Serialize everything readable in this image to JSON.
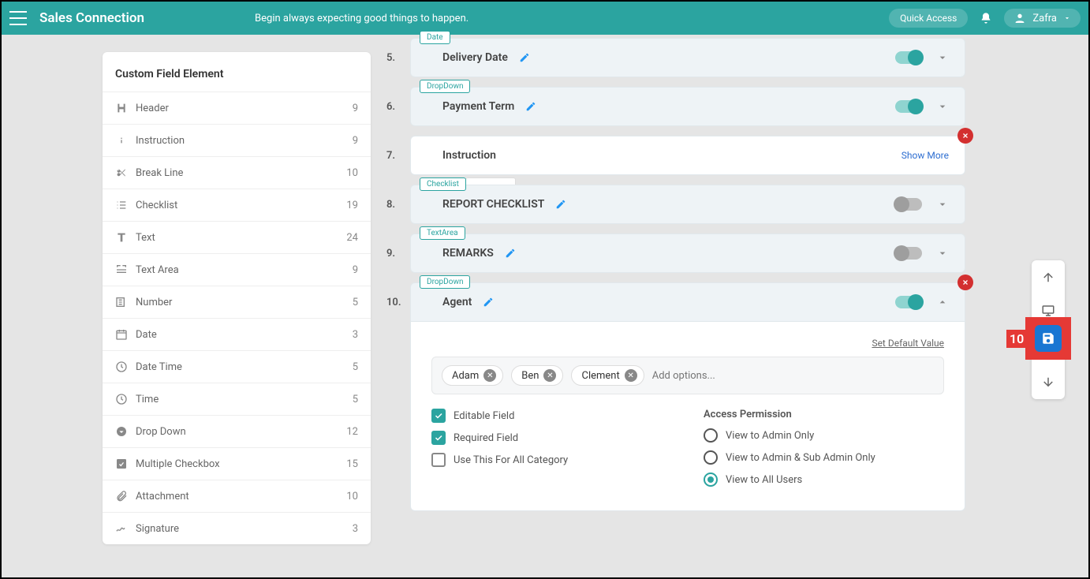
{
  "header": {
    "brand": "Sales Connection",
    "motto": "Begin always expecting good things to happen.",
    "quick_access": "Quick Access",
    "user_name": "Zafra"
  },
  "sidebar": {
    "title": "Custom Field Element",
    "items": [
      {
        "label": "Header",
        "count": "9",
        "iconkey": "header"
      },
      {
        "label": "Instruction",
        "count": "9",
        "iconkey": "info"
      },
      {
        "label": "Break Line",
        "count": "10",
        "iconkey": "cut"
      },
      {
        "label": "Checklist",
        "count": "19",
        "iconkey": "list"
      },
      {
        "label": "Text",
        "count": "24",
        "iconkey": "text"
      },
      {
        "label": "Text Area",
        "count": "9",
        "iconkey": "textarea"
      },
      {
        "label": "Number",
        "count": "5",
        "iconkey": "number"
      },
      {
        "label": "Date",
        "count": "3",
        "iconkey": "date"
      },
      {
        "label": "Date Time",
        "count": "5",
        "iconkey": "clock"
      },
      {
        "label": "Time",
        "count": "5",
        "iconkey": "clock"
      },
      {
        "label": "Drop Down",
        "count": "12",
        "iconkey": "dropdown"
      },
      {
        "label": "Multiple Checkbox",
        "count": "15",
        "iconkey": "mcheck"
      },
      {
        "label": "Attachment",
        "count": "10",
        "iconkey": "attach"
      },
      {
        "label": "Signature",
        "count": "3",
        "iconkey": "sign"
      }
    ]
  },
  "fields": [
    {
      "num": "5.",
      "tag": "Date",
      "title": "Delivery Date",
      "toggle": "on",
      "chev": "down"
    },
    {
      "num": "6.",
      "tag": "DropDown",
      "title": "Payment Term",
      "toggle": "on",
      "chev": "down"
    },
    {
      "num": "7.",
      "tag": "",
      "title": "Instruction",
      "plain": true,
      "showmore": "Show More",
      "del": true
    },
    {
      "num": "8.",
      "tag": "Checklist",
      "tagextra": true,
      "title": "REPORT CHECKLIST",
      "toggle": "off",
      "chev": "down"
    },
    {
      "num": "9.",
      "tag": "TextArea",
      "title": "REMARKS",
      "toggle": "off",
      "chev": "down"
    },
    {
      "num": "10.",
      "tag": "DropDown",
      "title": "Agent",
      "toggle": "on",
      "chev": "up",
      "del": true,
      "expanded": true
    }
  ],
  "agent_panel": {
    "set_default": "Set Default Value",
    "chips": [
      "Adam",
      "Ben",
      "Clement"
    ],
    "placeholder": "Add options...",
    "checkboxes": [
      {
        "label": "Editable Field",
        "checked": true
      },
      {
        "label": "Required Field",
        "checked": true
      },
      {
        "label": "Use This For All Category",
        "checked": false
      }
    ],
    "perm_title": "Access Permission",
    "radios": [
      {
        "label": "View to Admin Only",
        "sel": false
      },
      {
        "label": "View to Admin & Sub Admin Only",
        "sel": false
      },
      {
        "label": "View to All Users",
        "sel": true
      }
    ]
  },
  "callout_num": "10"
}
